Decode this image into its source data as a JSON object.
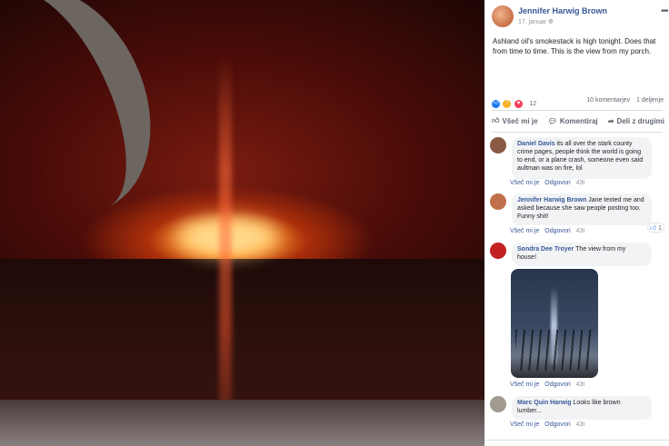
{
  "post": {
    "author": "Jennifer Harwig Brown",
    "date": "17. januar",
    "visibility_icon": "globe-icon",
    "text": "Ashland oil's smokestack is high tonight. Does that from time to time. This is the view from my porch.",
    "reactions": {
      "icons": [
        "like",
        "wow",
        "love"
      ],
      "count": "12"
    },
    "comments_count": "10 komentarjev",
    "shares_count": "1 deljenje",
    "actions": {
      "like": "Všeč mi je",
      "comment": "Komentiraj",
      "share": "Deli z drugimi"
    }
  },
  "comments": [
    {
      "author": "Daniel Davis",
      "text": "its all over the stark county crime pages, people think the world is going to end, or a plane crash, someone even said aultman was on fire, lol",
      "like": "Všeč mi je",
      "reply": "Odgovori",
      "time": "43t",
      "avatar_color": "#8a5a44"
    },
    {
      "author": "Jennifer Harwig Brown",
      "text": "Jane texted me and asked because she saw people posting too. Funny shit!",
      "like": "Všeč mi je",
      "reply": "Odgovori",
      "time": "43t",
      "likes": "1",
      "avatar_color": "#c0704a"
    },
    {
      "author": "Sondra Dee Troyer",
      "text": "The view from my house!",
      "like": "Všeč mi je",
      "reply": "Odgovori",
      "time": "43t",
      "avatar_color": "#c22222"
    },
    {
      "author": "Marc Quin Harwig",
      "text": "Looks like brown lumber...",
      "like": "Všeč mi je",
      "reply": "Odgovori",
      "time": "43t",
      "avatar_color": "#a09a90"
    }
  ]
}
